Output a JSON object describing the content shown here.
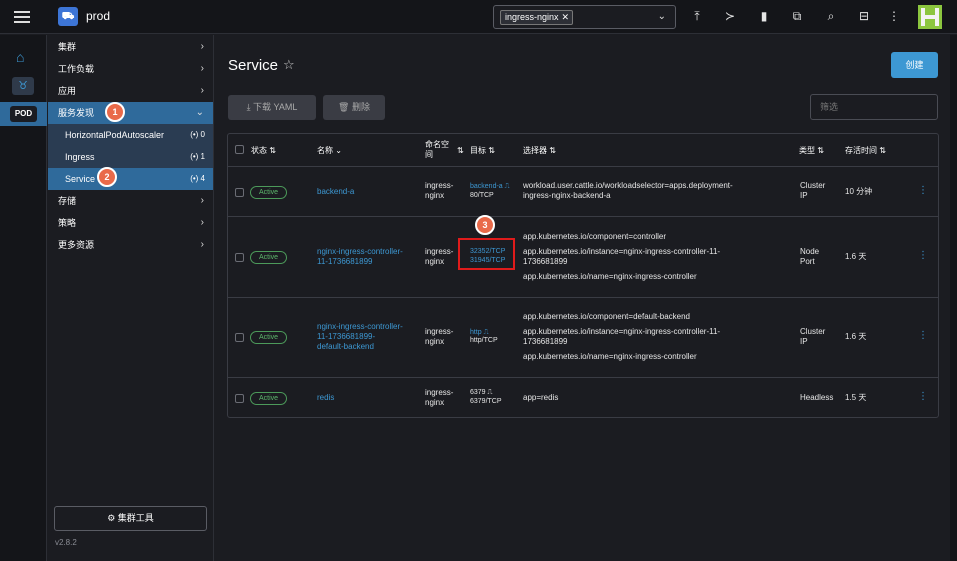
{
  "topbar": {
    "cluster_name": "prod",
    "namespace_chip": "ingress-nginx",
    "namespace_chip_close": "✕",
    "icons": [
      "hamburger-icon",
      "cluster-logo-icon",
      "upload-icon",
      "terminal-icon",
      "file-icon",
      "copy-icon",
      "search-icon",
      "book-icon",
      "more-icon",
      "avatar"
    ]
  },
  "rail": {
    "home_icon": "⌂",
    "cluster_icon": "♉",
    "pod_label": "POD"
  },
  "nav": {
    "items": [
      {
        "label": "集群",
        "chev": "›"
      },
      {
        "label": "工作负载",
        "chev": "›"
      },
      {
        "label": "应用",
        "chev": "›"
      },
      {
        "label": "服务发现",
        "chev": "⌄"
      },
      {
        "label": "存储",
        "chev": "›"
      },
      {
        "label": "策略",
        "chev": "›"
      },
      {
        "label": "更多资源",
        "chev": "›"
      }
    ],
    "sub_items": [
      {
        "label": "HorizontalPodAutoscaler",
        "count": "(•) 0"
      },
      {
        "label": "Ingress",
        "count": "(•) 1"
      },
      {
        "label": "Service",
        "count": "(•) 4"
      }
    ],
    "badges": [
      "1",
      "2",
      "3"
    ],
    "cluster_tools": "⚙ 集群工具",
    "version": "v2.8.2"
  },
  "main": {
    "title": "Service",
    "star": "☆",
    "create_button": "创建",
    "download_button": "⤓  下载 YAML",
    "delete_button": "🗑  删除",
    "filter_placeholder": "筛选",
    "headers": {
      "state": "状态 ⇅",
      "name": "名称 ⌄",
      "namespace_line1": "命名空",
      "namespace_line2": "间",
      "namespace_sort": "⇅",
      "target": "目标 ⇅",
      "selector": "选择器 ⇅",
      "type": "类型 ⇅",
      "age": "存活时间 ⇅"
    },
    "rows": [
      {
        "state": "Active",
        "name": "backend-a",
        "ns1": "ingress-",
        "ns2": "nginx",
        "target_link": "backend-a ⎍",
        "target_port": "80/TCP",
        "selectors": [
          "workload.user.cattle.io/workloadselector=apps.deployment-",
          "ingress-nginx-backend-a"
        ],
        "type1": "Cluster",
        "type2": "IP",
        "age": "10 分钟",
        "kebab": "⋮"
      },
      {
        "state": "Active",
        "name1": "nginx-ingress-controller-",
        "name2": "11-1736681899",
        "ns1": "ingress-",
        "ns2": "nginx",
        "target_link1": "32352/TCP",
        "target_link2": "31945/TCP",
        "selectors": [
          "app.kubernetes.io/component=controller",
          "app.kubernetes.io/instance=nginx-ingress-controller-11-",
          "1736681899",
          "app.kubernetes.io/name=nginx-ingress-controller"
        ],
        "type1": "Node",
        "type2": "Port",
        "age": "1.6 天",
        "kebab": "⋮"
      },
      {
        "state": "Active",
        "name1": "nginx-ingress-controller-",
        "name2": "11-1736681899-",
        "name3": "default-backend",
        "ns1": "ingress-",
        "ns2": "nginx",
        "target_link": "http ⎍",
        "target_port": "http/TCP",
        "selectors": [
          "app.kubernetes.io/component=default-backend",
          "app.kubernetes.io/instance=nginx-ingress-controller-11-",
          "1736681899",
          "app.kubernetes.io/name=nginx-ingress-controller"
        ],
        "type1": "Cluster",
        "type2": "IP",
        "age": "1.6 天",
        "kebab": "⋮"
      },
      {
        "state": "Active",
        "name": "redis",
        "ns1": "ingress-",
        "ns2": "nginx",
        "target_link": "6379 ⎍",
        "target_port": "6379/TCP",
        "selectors": [
          "app=redis"
        ],
        "type": "Headless",
        "age": "1.5 天",
        "kebab": "⋮"
      }
    ]
  },
  "colors": {
    "accent": "#3d98d3",
    "badge": "#e96a4a",
    "active": "#5db86c",
    "highlight": "#e01b1b"
  }
}
